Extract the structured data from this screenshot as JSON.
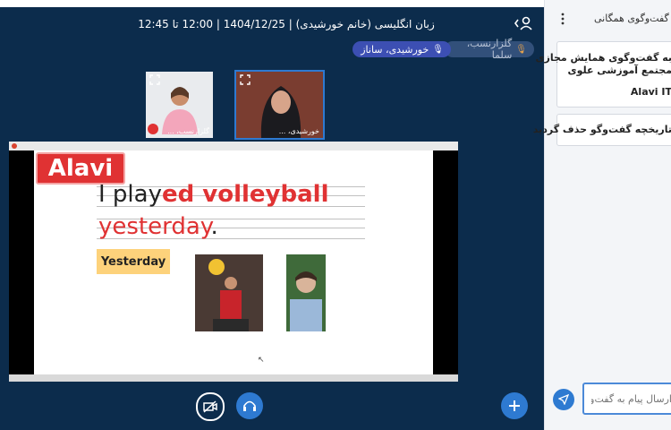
{
  "header": {
    "title": "زبان انگلیسی (خانم خورشیدی) | 1404/12/25 | 12:00 تا 12:45"
  },
  "presenters": [
    {
      "name": "گلزارنسب، سلما"
    },
    {
      "name": "خورشیدی، ساناز"
    }
  ],
  "tiles": [
    {
      "name": "گلزارنسب، ..."
    },
    {
      "name": "خورشیدی، ..."
    }
  ],
  "slide": {
    "logo": "Alavi",
    "sentence_plain": "I play",
    "sentence_red": "ed volleyball",
    "word2": "yesterday",
    "dot": ".",
    "label": "Yesterday"
  },
  "sidebar": {
    "title": "گفت‌وگوی همگانی",
    "card1_line1": "به گفت‌وگوی همایش مجازی",
    "card1_line2": "مجتمع آموزشی علوی",
    "card1_line3": "Alavi IT",
    "card2_text": "تاریخچه گفت‌وگو حذف گردید",
    "input_placeholder": "ارسال پیام به گفت‌وگوی همگانی"
  },
  "colors": {
    "stage_bg": "#0c2c4c",
    "accent": "#2e7ad1",
    "logo_red": "#e03233"
  }
}
